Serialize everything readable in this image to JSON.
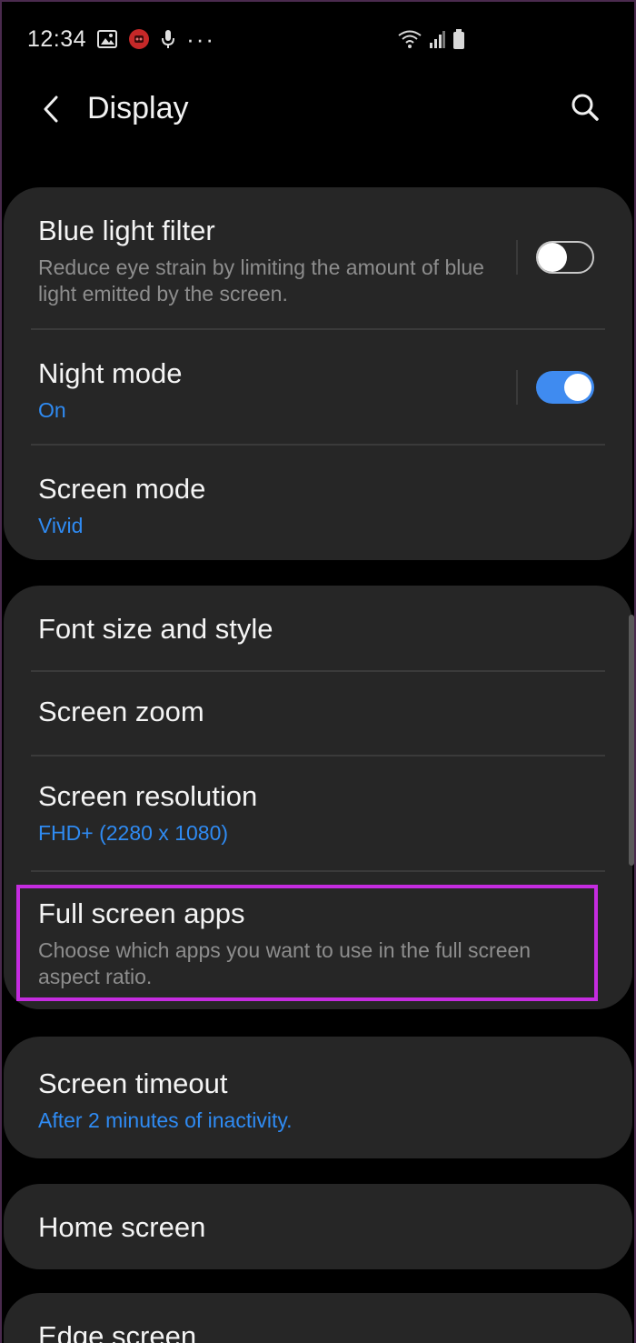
{
  "status_bar": {
    "time": "12:34",
    "left_icons": [
      "gallery-icon",
      "notification-app-icon",
      "mic-icon",
      "more-dots-icon"
    ],
    "right_icons": [
      "wifi-icon",
      "signal-icon",
      "battery-icon"
    ],
    "more_dots": "···"
  },
  "header": {
    "title": "Display",
    "back_icon": "back-arrow-icon",
    "search_icon": "search-icon"
  },
  "colors": {
    "background": "#000000",
    "card": "#262626",
    "accent": "#2f8bf3",
    "highlight": "#c52ce0"
  },
  "group1": {
    "blue_light": {
      "title": "Blue light filter",
      "subtitle": "Reduce eye strain by limiting the amount of blue light emitted by the screen.",
      "toggle": "off"
    },
    "night_mode": {
      "title": "Night mode",
      "subtitle": "On",
      "toggle": "on"
    },
    "screen_mode": {
      "title": "Screen mode",
      "subtitle": "Vivid"
    }
  },
  "group2": {
    "font": {
      "title": "Font size and style"
    },
    "zoom": {
      "title": "Screen zoom"
    },
    "resolution": {
      "title": "Screen resolution",
      "subtitle": "FHD+ (2280 x 1080)"
    },
    "full_screen": {
      "title": "Full screen apps",
      "subtitle": "Choose which apps you want to use in the full screen aspect ratio."
    }
  },
  "group3": {
    "timeout": {
      "title": "Screen timeout",
      "subtitle": "After 2 minutes of inactivity."
    }
  },
  "group4": {
    "home": {
      "title": "Home screen"
    }
  },
  "group5": {
    "edge": {
      "title": "Edge screen"
    }
  }
}
